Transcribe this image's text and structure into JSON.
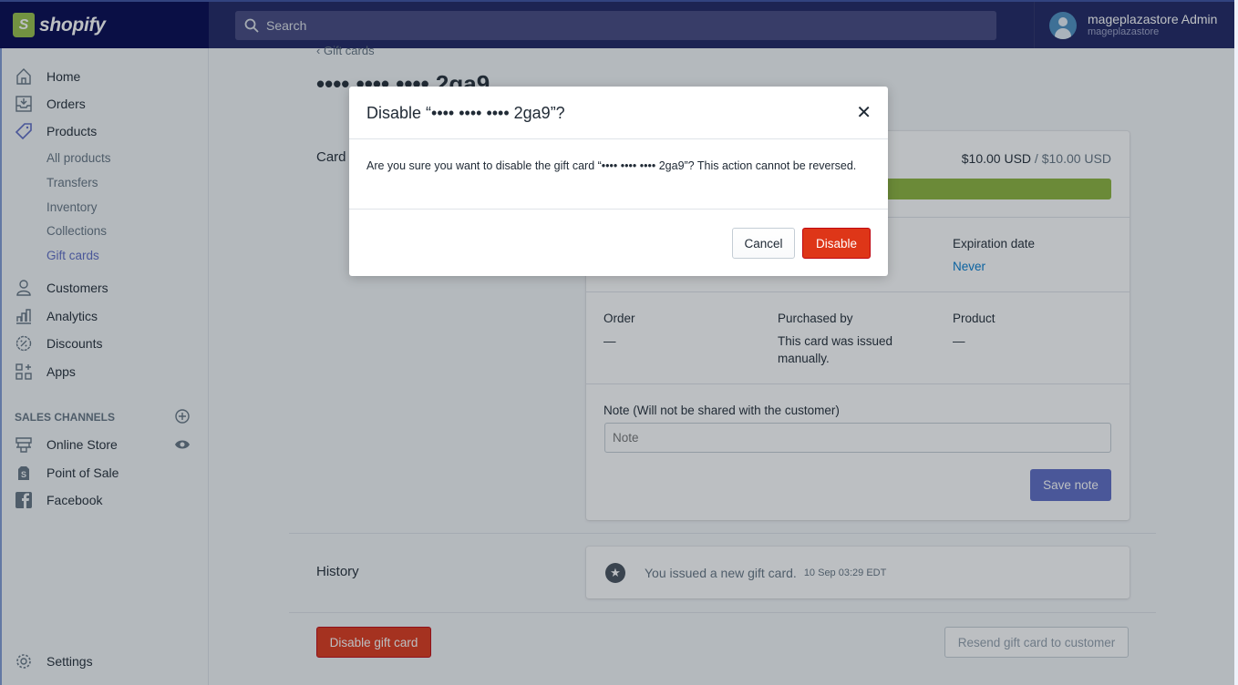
{
  "topbar": {
    "logo_text": "shopify",
    "logo_glyph": "S",
    "search_placeholder": "Search",
    "user_name": "mageplazastore Admin",
    "user_store": "mageplazastore"
  },
  "sidebar": {
    "items": [
      {
        "label": "Home",
        "icon": "home-icon"
      },
      {
        "label": "Orders",
        "icon": "orders-icon"
      },
      {
        "label": "Products",
        "icon": "tag-icon"
      }
    ],
    "sub_items": [
      {
        "label": "All products",
        "active": false
      },
      {
        "label": "Transfers",
        "active": false
      },
      {
        "label": "Inventory",
        "active": false
      },
      {
        "label": "Collections",
        "active": false
      },
      {
        "label": "Gift cards",
        "active": true
      }
    ],
    "items2": [
      {
        "label": "Customers",
        "icon": "customers-icon"
      },
      {
        "label": "Analytics",
        "icon": "analytics-icon"
      },
      {
        "label": "Discounts",
        "icon": "discounts-icon"
      },
      {
        "label": "Apps",
        "icon": "apps-icon"
      }
    ],
    "sales_channels_title": "SALES CHANNELS",
    "channels": [
      {
        "label": "Online Store",
        "icon": "store-icon"
      },
      {
        "label": "Point of Sale",
        "icon": "pos-icon"
      },
      {
        "label": "Facebook",
        "icon": "facebook-icon"
      }
    ],
    "settings_label": "Settings"
  },
  "main": {
    "back_label": "Gift cards",
    "title": "•••• •••• •••• 2ga9",
    "card_label": "Card",
    "balance_current": "$10.00 USD",
    "balance_separator": " / ",
    "balance_total": "$10.00 USD",
    "balance_fraction": 1.0,
    "expiration_label": "Expiration date",
    "expiration_value": "Never",
    "order_label": "Order",
    "order_value": "—",
    "purchased_label": "Purchased by",
    "purchased_value": "This card was issued manually.",
    "product_label": "Product",
    "product_value": "—",
    "note_label": "Note (Will not be shared with the customer)",
    "note_placeholder": "Note",
    "save_note": "Save note",
    "history_label": "History",
    "history_text": "You issued a new gift card.",
    "history_time": "10 Sep 03:29  EDT",
    "disable_button": "Disable gift card",
    "resend_button": "Resend gift card to customer"
  },
  "modal": {
    "title": "Disable “•••• •••• •••• 2ga9”?",
    "body": "Are you sure you want to disable the gift card “•••• •••• •••• 2ga9”? This action cannot be reversed.",
    "close": "✕",
    "cancel": "Cancel",
    "confirm": "Disable"
  }
}
